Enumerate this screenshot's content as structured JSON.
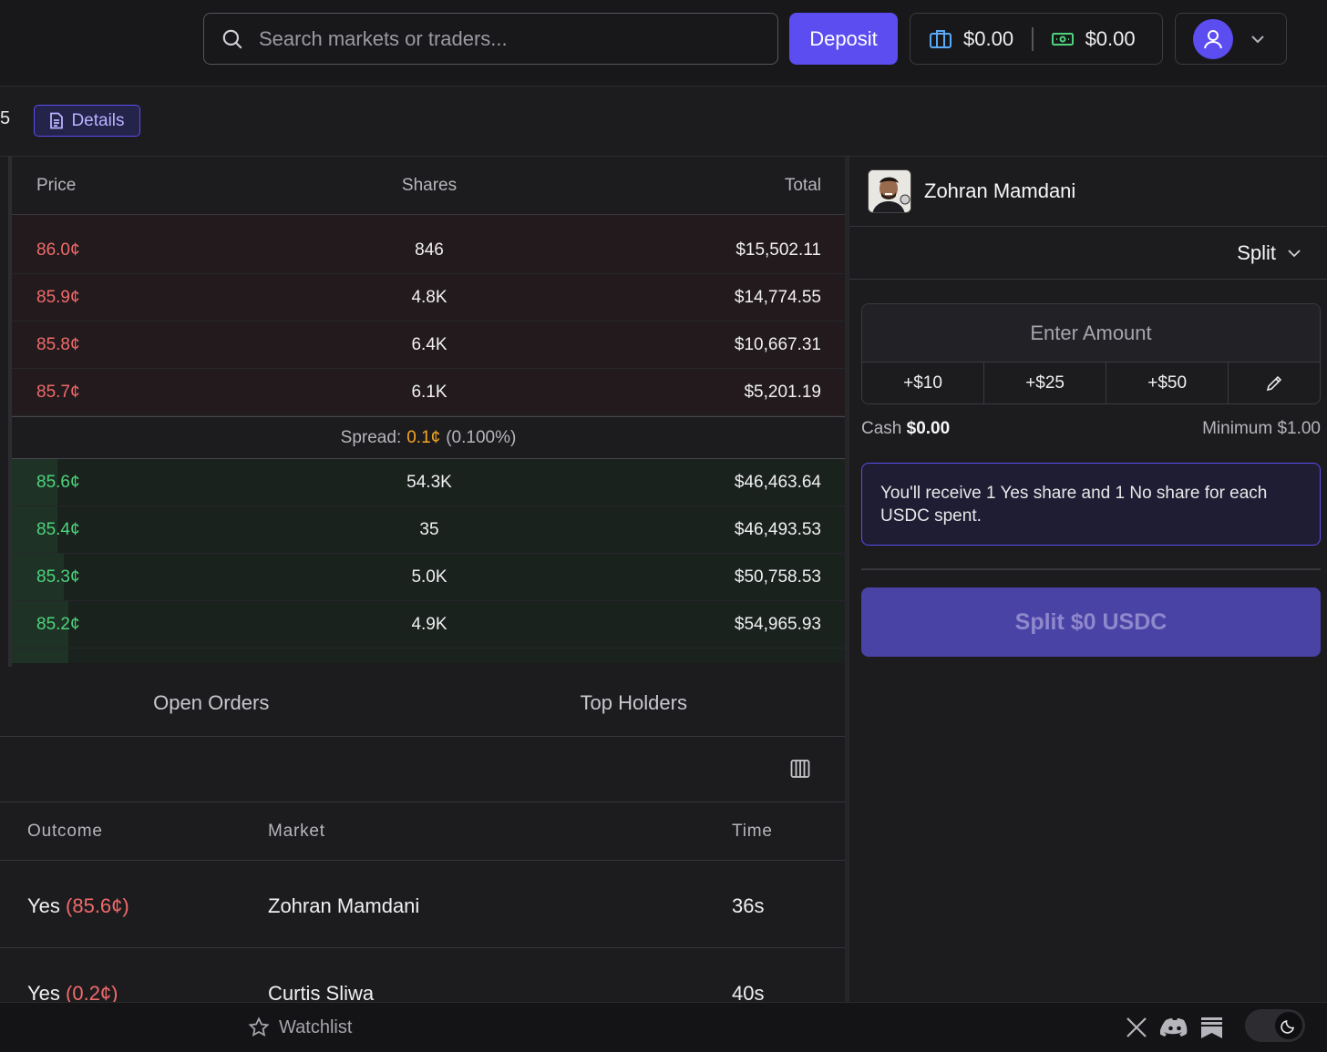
{
  "header": {
    "search_placeholder": "Search markets or traders...",
    "deposit_label": "Deposit",
    "portfolio_balance": "$0.00",
    "cash_balance": "$0.00"
  },
  "subheader": {
    "cut_text": "5",
    "details_label": "Details"
  },
  "orderbook": {
    "columns": {
      "price": "Price",
      "shares": "Shares",
      "total": "Total"
    },
    "asks": [
      {
        "price": "86.0¢",
        "shares": "846",
        "total": "$15,502.11",
        "depth": 0.0
      },
      {
        "price": "85.9¢",
        "shares": "4.8K",
        "total": "$14,774.55",
        "depth": 0.0
      },
      {
        "price": "85.8¢",
        "shares": "6.4K",
        "total": "$10,667.31",
        "depth": 0.0
      },
      {
        "price": "85.7¢",
        "shares": "6.1K",
        "total": "$5,201.19",
        "depth": 0.0
      }
    ],
    "spread": {
      "label": "Spread:",
      "value": "0.1¢",
      "pct": "(0.100%)"
    },
    "bids": [
      {
        "price": "85.6¢",
        "shares": "54.3K",
        "total": "$46,463.64",
        "depth": 0.055
      },
      {
        "price": "85.4¢",
        "shares": "35",
        "total": "$46,493.53",
        "depth": 0.055
      },
      {
        "price": "85.3¢",
        "shares": "5.0K",
        "total": "$50,758.53",
        "depth": 0.062
      },
      {
        "price": "85.2¢",
        "shares": "4.9K",
        "total": "$54,965.93",
        "depth": 0.068
      }
    ]
  },
  "tabs": [
    "Open Orders",
    "Top Holders"
  ],
  "orders": {
    "columns": {
      "outcome": "Outcome",
      "market": "Market",
      "time": "Time"
    },
    "rows": [
      {
        "outcome": "Yes",
        "price": "(85.6¢)",
        "market": "Zohran Mamdani",
        "time": "36s"
      },
      {
        "outcome": "Yes",
        "price": "(0.2¢)",
        "market": "Curtis Sliwa",
        "time": "40s"
      }
    ]
  },
  "trade_panel": {
    "market_title": "Zohran Mamdani",
    "mode_label": "Split",
    "amount_placeholder": "Enter Amount",
    "quick_amounts": [
      "+$10",
      "+$25",
      "+$50"
    ],
    "cash_label": "Cash",
    "cash_value": "$0.00",
    "minimum_label": "Minimum $1.00",
    "info_text": "You'll receive 1 Yes share and 1 No share for each USDC spent.",
    "submit_label": "Split $0 USDC"
  },
  "footer": {
    "watchlist_label": "Watchlist"
  },
  "colors": {
    "accent": "#5b4df0",
    "ask": "#f06a6a",
    "bid": "#4ed37c",
    "spread_highlight": "#f5a623"
  }
}
